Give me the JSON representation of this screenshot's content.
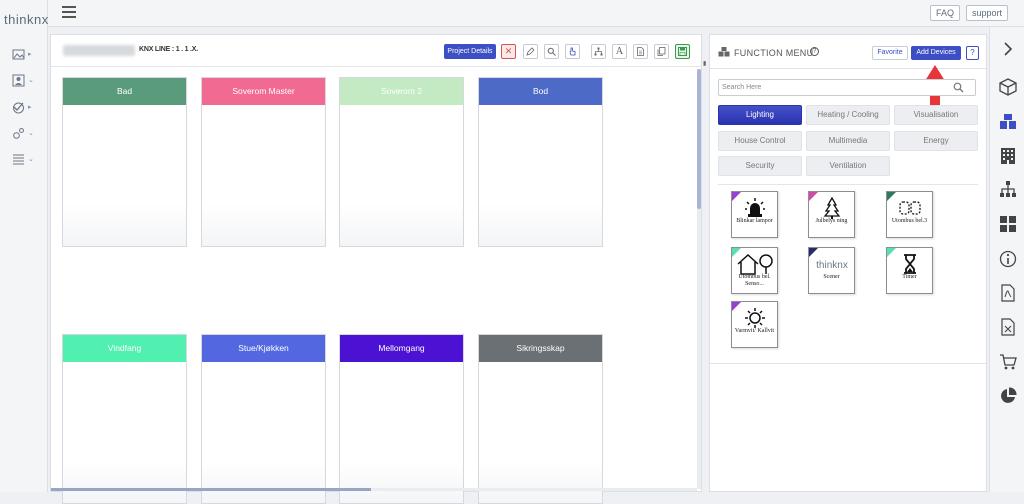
{
  "app": {
    "logo": "thinknx"
  },
  "topbar": {
    "faq": "FAQ",
    "support": "support"
  },
  "toolbar": {
    "knx_line": "KNX LINE : 1 . 1 .X.",
    "project_details": "Project Details"
  },
  "rooms": [
    {
      "name": "Bad",
      "color": "#5a9b7c"
    },
    {
      "name": "Soverom Master",
      "color": "#f06a91"
    },
    {
      "name": "Soverom 2",
      "color": "#c4eac4"
    },
    {
      "name": "Bod",
      "color": "#4d6ac6"
    },
    {
      "name": "Vindfang",
      "color": "#52f0b0"
    },
    {
      "name": "Stue/Kjøkken",
      "color": "#5368e0"
    },
    {
      "name": "Mellomgang",
      "color": "#4b12d3"
    },
    {
      "name": "Sikringsskap",
      "color": "#6b7074"
    }
  ],
  "function_menu": {
    "title": "FUNCTION MENU",
    "help": "?",
    "favorite": "Favorite",
    "add_devices": "Add Devices",
    "question": "?",
    "search_placeholder": "Search Here",
    "categories": [
      "Lighting",
      "Heating / Cooling",
      "Visualisation",
      "House Control",
      "Multimedia",
      "Energy",
      "Security",
      "Ventilation"
    ],
    "active_category": "Lighting",
    "devices": [
      {
        "label": "Blinkar lampor",
        "icon": "alarm-light-icon",
        "corner": "#9a3fd0"
      },
      {
        "label": "Julbelys ning",
        "icon": "christmas-tree-icon",
        "corner": "#d04aa8"
      },
      {
        "label": "Utombus bel.3",
        "icon": "dashed-lamps-icon",
        "corner": "#2e7a5a"
      },
      {
        "label": "Utombus bel. Senso...",
        "icon": "house-tree-icon",
        "corner": "#58e0b0"
      },
      {
        "label": "Scener",
        "icon": "thinknx-logo-icon",
        "corner": "#2a2a6a"
      },
      {
        "label": "Timer",
        "icon": "hourglass-icon",
        "corner": "#58e0b0"
      },
      {
        "label": "Varmvit/ Kallvit",
        "icon": "sun-icon",
        "corner": "#9a3fd0"
      }
    ]
  }
}
